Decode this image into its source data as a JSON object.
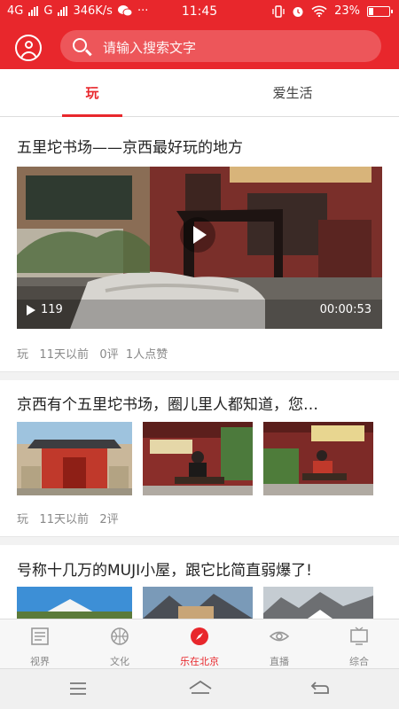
{
  "status_bar": {
    "carrier1": "4G",
    "carrier2": "G",
    "speed": "346K/s",
    "dots": "···",
    "time": "11:45",
    "battery": "23%"
  },
  "header": {
    "search_placeholder": "请输入搜索文字"
  },
  "tabs": [
    {
      "label": "玩",
      "active": true
    },
    {
      "label": "爱生活",
      "active": false
    }
  ],
  "articles": [
    {
      "title": "五里坨书场——京西最好玩的地方",
      "video": {
        "views": "119",
        "duration": "00:00:53"
      },
      "meta": {
        "category": "玩",
        "time": "11天以前",
        "comments": "0评",
        "likes": "1人点赞"
      }
    },
    {
      "title": "京西有个五里坨书场，圈儿里人都知道，您…",
      "meta": {
        "category": "玩",
        "time": "11天以前",
        "comments": "2评"
      }
    },
    {
      "title": "号称十几万的MUJI小屋，跟它比简直弱爆了!"
    }
  ],
  "bottom_nav": [
    {
      "label": "视界",
      "icon": "newspaper-icon",
      "active": false
    },
    {
      "label": "文化",
      "icon": "basketball-icon",
      "active": false
    },
    {
      "label": "乐在北京",
      "icon": "compass-icon",
      "active": true
    },
    {
      "label": "直播",
      "icon": "eye-icon",
      "active": false
    },
    {
      "label": "综合",
      "icon": "tv-icon",
      "active": false
    }
  ],
  "colors": {
    "brand": "#e8272c",
    "text": "#222222",
    "meta": "#888888"
  }
}
